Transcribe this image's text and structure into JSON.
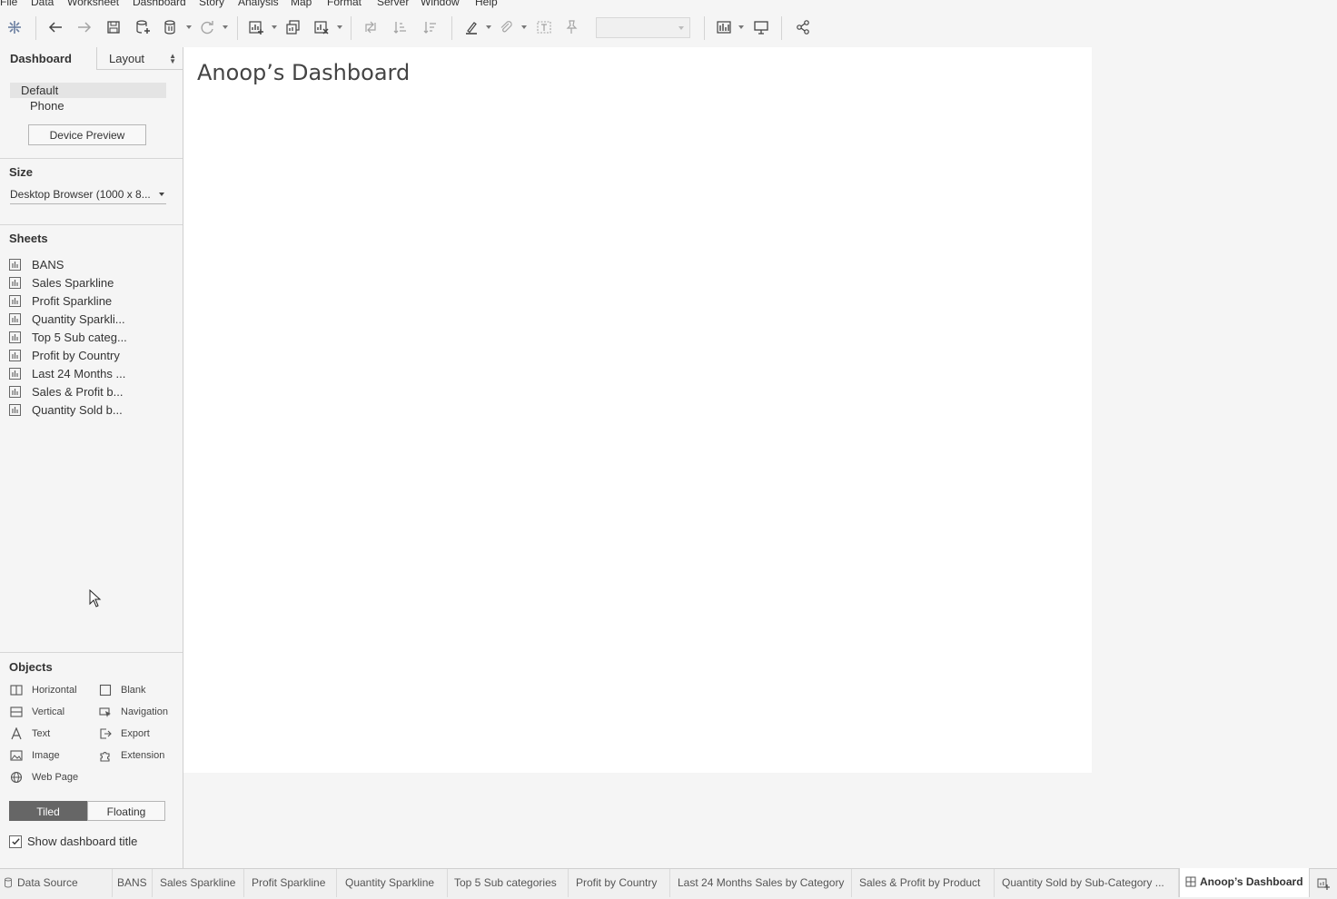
{
  "menu": [
    "File",
    "Data",
    "Worksheet",
    "Dashboard",
    "Story",
    "Analysis",
    "Map",
    "Format",
    "Server",
    "Window",
    "Help"
  ],
  "left_panel": {
    "tab_dashboard": "Dashboard",
    "tab_layout": "Layout",
    "devices": {
      "default": "Default",
      "phone": "Phone"
    },
    "device_preview_button": "Device Preview",
    "size": {
      "title": "Size",
      "value": "Desktop Browser (1000 x 8..."
    },
    "sheets": {
      "title": "Sheets",
      "items": [
        "BANS",
        "Sales Sparkline",
        "Profit Sparkline",
        "Quantity Sparkli...",
        "Top 5 Sub categ...",
        "Profit by Country",
        "Last 24 Months ...",
        "Sales & Profit b...",
        "Quantity Sold b..."
      ]
    },
    "objects": {
      "title": "Objects",
      "horizontal": "Horizontal",
      "blank": "Blank",
      "vertical": "Vertical",
      "navigation": "Navigation",
      "text": "Text",
      "export": "Export",
      "image": "Image",
      "extension": "Extension",
      "web_page": "Web Page"
    },
    "tiled": "Tiled",
    "floating": "Floating",
    "show_title_label": "Show dashboard title",
    "show_title_checked": true
  },
  "dashboard": {
    "title": "Anoop’s Dashboard"
  },
  "bottom_tabs": {
    "data_source": "Data Source",
    "items": [
      "BANS",
      "Sales Sparkline",
      "Profit Sparkline",
      "Quantity Sparkline",
      "Top 5 Sub categories",
      "Profit by Country",
      "Last 24 Months Sales by Category",
      "Sales & Profit by Product",
      "Quantity Sold by Sub-Category ..."
    ],
    "active": "Anoop’s Dashboard"
  },
  "colors": {
    "accent_dark": "#666666",
    "canvas": "#ffffff",
    "chrome": "#f5f5f5"
  }
}
